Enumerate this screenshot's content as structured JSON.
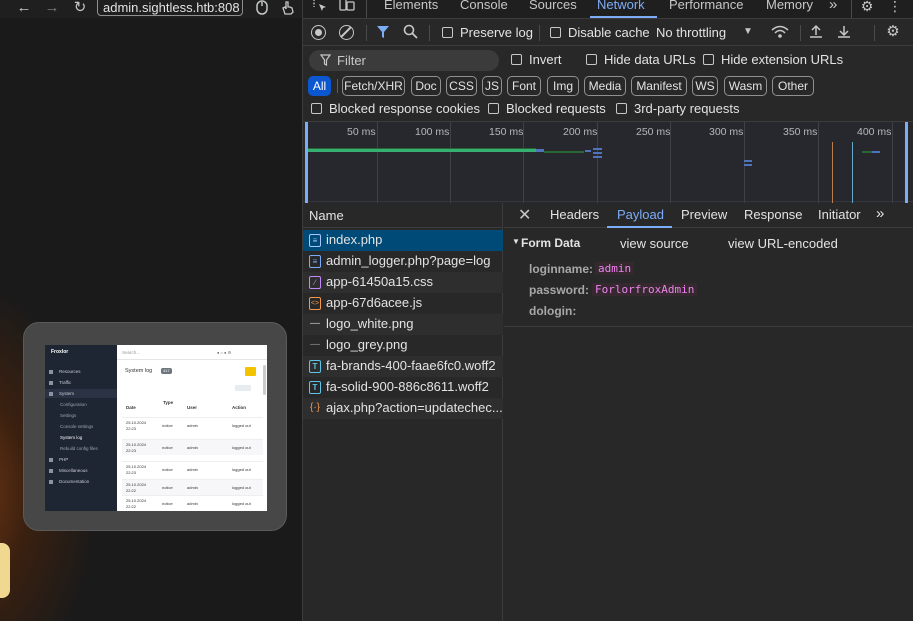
{
  "browser": {
    "url": "admin.sightless.htb:808",
    "back_icon": "arrow-left-icon",
    "forward_icon": "arrow-right-icon",
    "reload_icon": "reload-icon"
  },
  "pip": {
    "brand": "Froxlor",
    "search_placeholder": "Search...",
    "sidebar": [
      "Resources",
      "Traffic",
      "System",
      "Configuration",
      "Settings",
      "Console settings",
      "System log",
      "Rebuild config files",
      "PHP",
      "Miscellaneous",
      "Documentation"
    ],
    "page_title": "System log",
    "badge": "417",
    "columns": [
      "Date",
      "Type",
      "User",
      "Action"
    ],
    "rows": [
      {
        "date": "25.10.2024",
        "time": "22:23",
        "type": "notice",
        "user": "admin",
        "action": "logged out"
      },
      {
        "date": "25.10.2024",
        "time": "22:23",
        "type": "notice",
        "user": "admin",
        "action": "logged out"
      },
      {
        "date": "25.10.2024",
        "time": "22:23",
        "type": "notice",
        "user": "admin",
        "action": "logged out"
      },
      {
        "date": "25.10.2024",
        "time": "22:22",
        "type": "notice",
        "user": "admin",
        "action": "logged out"
      },
      {
        "date": "25.10.2024",
        "time": "22:22",
        "type": "notice",
        "user": "admin",
        "action": "logged out"
      }
    ]
  },
  "devtools": {
    "tabs": [
      "Elements",
      "Console",
      "Sources",
      "Network",
      "Performance",
      "Memory"
    ],
    "active_tab": "Network",
    "more_tabs": "»",
    "toolbar": {
      "preserve_log": "Preserve log",
      "disable_cache": "Disable cache",
      "throttling": "No throttling"
    },
    "filter": {
      "placeholder": "Filter",
      "invert": "Invert",
      "hide_data_urls": "Hide data URLs",
      "hide_extension_urls": "Hide extension URLs"
    },
    "type_filters": [
      "All",
      "Fetch/XHR",
      "Doc",
      "CSS",
      "JS",
      "Font",
      "Img",
      "Media",
      "Manifest",
      "WS",
      "Wasm",
      "Other"
    ],
    "blocked": {
      "cookies": "Blocked response cookies",
      "requests": "Blocked requests",
      "third_party": "3rd-party requests"
    },
    "timeline_labels": [
      "50 ms",
      "100 ms",
      "150 ms",
      "200 ms",
      "250 ms",
      "300 ms",
      "350 ms",
      "400 ms"
    ],
    "name_header": "Name",
    "requests": [
      {
        "name": "index.php",
        "icon": "document-icon"
      },
      {
        "name": "admin_logger.php?page=log",
        "icon": "document-icon"
      },
      {
        "name": "app-61450a15.css",
        "icon": "stylesheet-icon"
      },
      {
        "name": "app-67d6acee.js",
        "icon": "script-icon"
      },
      {
        "name": "logo_white.png",
        "icon": "image-icon"
      },
      {
        "name": "logo_grey.png",
        "icon": "image-icon"
      },
      {
        "name": "fa-brands-400-faae6fc0.woff2",
        "icon": "font-icon"
      },
      {
        "name": "fa-solid-900-886c8611.woff2",
        "icon": "font-icon"
      },
      {
        "name": "ajax.php?action=updatechec...",
        "icon": "xhr-icon"
      }
    ],
    "detail_tabs": [
      "Headers",
      "Payload",
      "Preview",
      "Response",
      "Initiator"
    ],
    "active_detail_tab": "Payload",
    "form_data": {
      "title": "Form Data",
      "view_source": "view source",
      "view_url_encoded": "view URL-encoded",
      "fields": [
        {
          "key": "loginname:",
          "value": "admin"
        },
        {
          "key": "password:",
          "value": "ForlorfroxAdmin"
        },
        {
          "key": "dologin:",
          "value": ""
        }
      ]
    }
  }
}
